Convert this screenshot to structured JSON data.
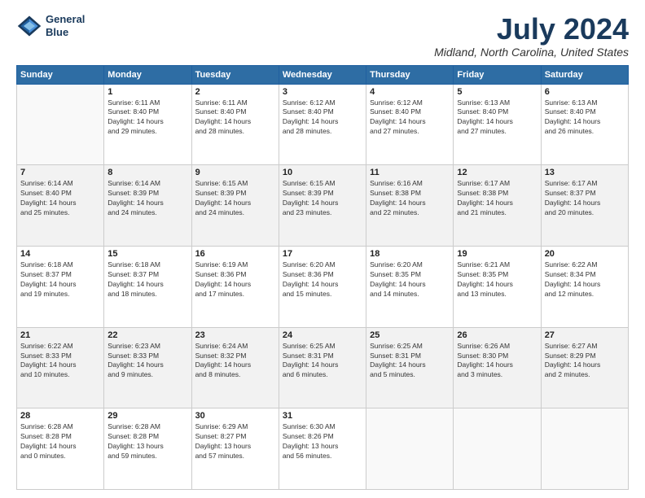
{
  "logo": {
    "line1": "General",
    "line2": "Blue"
  },
  "title": "July 2024",
  "location": "Midland, North Carolina, United States",
  "days_of_week": [
    "Sunday",
    "Monday",
    "Tuesday",
    "Wednesday",
    "Thursday",
    "Friday",
    "Saturday"
  ],
  "weeks": [
    [
      {
        "day": "",
        "info": ""
      },
      {
        "day": "1",
        "info": "Sunrise: 6:11 AM\nSunset: 8:40 PM\nDaylight: 14 hours\nand 29 minutes."
      },
      {
        "day": "2",
        "info": "Sunrise: 6:11 AM\nSunset: 8:40 PM\nDaylight: 14 hours\nand 28 minutes."
      },
      {
        "day": "3",
        "info": "Sunrise: 6:12 AM\nSunset: 8:40 PM\nDaylight: 14 hours\nand 28 minutes."
      },
      {
        "day": "4",
        "info": "Sunrise: 6:12 AM\nSunset: 8:40 PM\nDaylight: 14 hours\nand 27 minutes."
      },
      {
        "day": "5",
        "info": "Sunrise: 6:13 AM\nSunset: 8:40 PM\nDaylight: 14 hours\nand 27 minutes."
      },
      {
        "day": "6",
        "info": "Sunrise: 6:13 AM\nSunset: 8:40 PM\nDaylight: 14 hours\nand 26 minutes."
      }
    ],
    [
      {
        "day": "7",
        "info": "Sunrise: 6:14 AM\nSunset: 8:40 PM\nDaylight: 14 hours\nand 25 minutes."
      },
      {
        "day": "8",
        "info": "Sunrise: 6:14 AM\nSunset: 8:39 PM\nDaylight: 14 hours\nand 24 minutes."
      },
      {
        "day": "9",
        "info": "Sunrise: 6:15 AM\nSunset: 8:39 PM\nDaylight: 14 hours\nand 24 minutes."
      },
      {
        "day": "10",
        "info": "Sunrise: 6:15 AM\nSunset: 8:39 PM\nDaylight: 14 hours\nand 23 minutes."
      },
      {
        "day": "11",
        "info": "Sunrise: 6:16 AM\nSunset: 8:38 PM\nDaylight: 14 hours\nand 22 minutes."
      },
      {
        "day": "12",
        "info": "Sunrise: 6:17 AM\nSunset: 8:38 PM\nDaylight: 14 hours\nand 21 minutes."
      },
      {
        "day": "13",
        "info": "Sunrise: 6:17 AM\nSunset: 8:37 PM\nDaylight: 14 hours\nand 20 minutes."
      }
    ],
    [
      {
        "day": "14",
        "info": "Sunrise: 6:18 AM\nSunset: 8:37 PM\nDaylight: 14 hours\nand 19 minutes."
      },
      {
        "day": "15",
        "info": "Sunrise: 6:18 AM\nSunset: 8:37 PM\nDaylight: 14 hours\nand 18 minutes."
      },
      {
        "day": "16",
        "info": "Sunrise: 6:19 AM\nSunset: 8:36 PM\nDaylight: 14 hours\nand 17 minutes."
      },
      {
        "day": "17",
        "info": "Sunrise: 6:20 AM\nSunset: 8:36 PM\nDaylight: 14 hours\nand 15 minutes."
      },
      {
        "day": "18",
        "info": "Sunrise: 6:20 AM\nSunset: 8:35 PM\nDaylight: 14 hours\nand 14 minutes."
      },
      {
        "day": "19",
        "info": "Sunrise: 6:21 AM\nSunset: 8:35 PM\nDaylight: 14 hours\nand 13 minutes."
      },
      {
        "day": "20",
        "info": "Sunrise: 6:22 AM\nSunset: 8:34 PM\nDaylight: 14 hours\nand 12 minutes."
      }
    ],
    [
      {
        "day": "21",
        "info": "Sunrise: 6:22 AM\nSunset: 8:33 PM\nDaylight: 14 hours\nand 10 minutes."
      },
      {
        "day": "22",
        "info": "Sunrise: 6:23 AM\nSunset: 8:33 PM\nDaylight: 14 hours\nand 9 minutes."
      },
      {
        "day": "23",
        "info": "Sunrise: 6:24 AM\nSunset: 8:32 PM\nDaylight: 14 hours\nand 8 minutes."
      },
      {
        "day": "24",
        "info": "Sunrise: 6:25 AM\nSunset: 8:31 PM\nDaylight: 14 hours\nand 6 minutes."
      },
      {
        "day": "25",
        "info": "Sunrise: 6:25 AM\nSunset: 8:31 PM\nDaylight: 14 hours\nand 5 minutes."
      },
      {
        "day": "26",
        "info": "Sunrise: 6:26 AM\nSunset: 8:30 PM\nDaylight: 14 hours\nand 3 minutes."
      },
      {
        "day": "27",
        "info": "Sunrise: 6:27 AM\nSunset: 8:29 PM\nDaylight: 14 hours\nand 2 minutes."
      }
    ],
    [
      {
        "day": "28",
        "info": "Sunrise: 6:28 AM\nSunset: 8:28 PM\nDaylight: 14 hours\nand 0 minutes."
      },
      {
        "day": "29",
        "info": "Sunrise: 6:28 AM\nSunset: 8:28 PM\nDaylight: 13 hours\nand 59 minutes."
      },
      {
        "day": "30",
        "info": "Sunrise: 6:29 AM\nSunset: 8:27 PM\nDaylight: 13 hours\nand 57 minutes."
      },
      {
        "day": "31",
        "info": "Sunrise: 6:30 AM\nSunset: 8:26 PM\nDaylight: 13 hours\nand 56 minutes."
      },
      {
        "day": "",
        "info": ""
      },
      {
        "day": "",
        "info": ""
      },
      {
        "day": "",
        "info": ""
      }
    ]
  ]
}
